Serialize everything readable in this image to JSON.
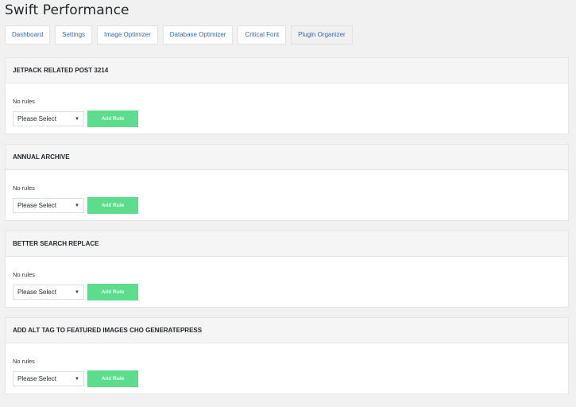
{
  "page_title": "Swift Performance",
  "tabs": [
    {
      "label": "Dashboard"
    },
    {
      "label": "Settings"
    },
    {
      "label": "Image Optimizer"
    },
    {
      "label": "Database Optimizer"
    },
    {
      "label": "Critical Font"
    },
    {
      "label": "Plugin Organizer"
    }
  ],
  "active_tab": "Plugin Organizer",
  "panels": [
    {
      "title": "JETPACK RELATED POST 3214",
      "status": "No rules",
      "select_value": "Please Select",
      "button_label": "Add Rule"
    },
    {
      "title": "ANNUAL ARCHIVE",
      "status": "No rules",
      "select_value": "Please Select",
      "button_label": "Add Rule"
    },
    {
      "title": "BETTER SEARCH REPLACE",
      "status": "No rules",
      "select_value": "Please Select",
      "button_label": "Add Rule"
    },
    {
      "title": "ADD ALT TAG TO FEATURED IMAGES CHO GENERATEPRESS",
      "status": "No rules",
      "select_value": "Please Select",
      "button_label": "Add Rule"
    }
  ],
  "icons": {
    "dropdown": "caret-down-icon"
  },
  "colors": {
    "accent_button": "#5cdd8b",
    "tab_text": "#2e6bb5"
  }
}
